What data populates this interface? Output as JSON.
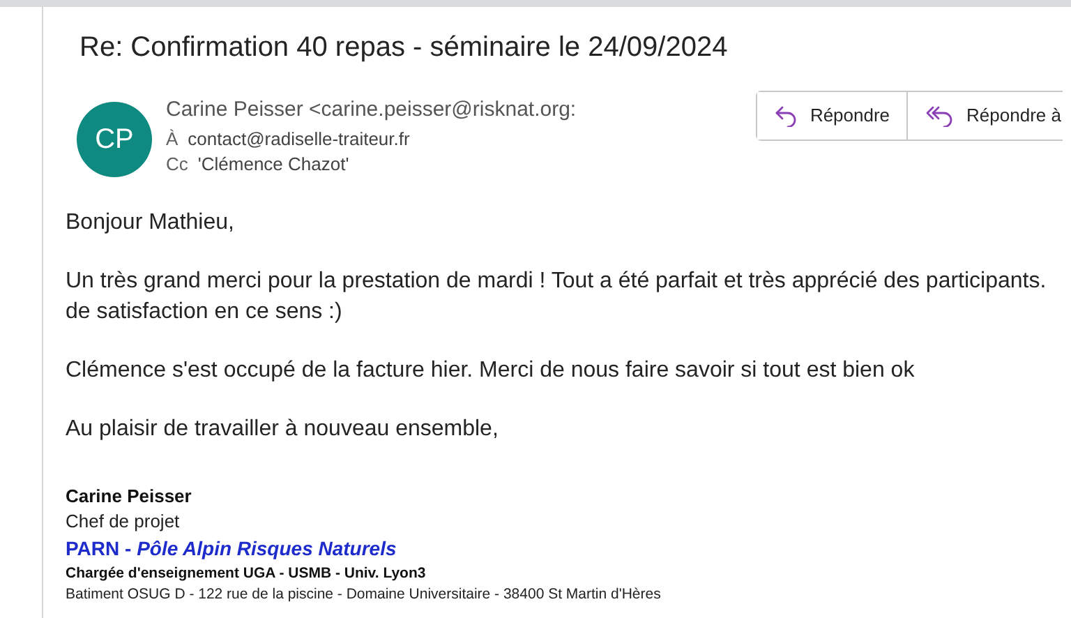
{
  "subject": "Re: Confirmation 40 repas - séminaire le 24/09/2024",
  "sender": {
    "initials": "CP",
    "from": "Carine Peisser <carine.peisser@risknat.org:",
    "to_label": "À",
    "to": "contact@radiselle-traiteur.fr",
    "cc_label": "Cc",
    "cc": "'Clémence Chazot'"
  },
  "actions": [
    {
      "kind": "reply",
      "label": "Répondre"
    },
    {
      "kind": "reply-all",
      "label": "Répondre à"
    }
  ],
  "body": [
    [
      "Bonjour Mathieu,"
    ],
    [
      "Un très grand merci pour la prestation de mardi ! Tout a été parfait et très apprécié des participants.",
      "de satisfaction en ce sens :)"
    ],
    [
      "Clémence s'est occupé de la facture hier. Merci de nous faire savoir si tout est bien ok"
    ],
    [
      "Au plaisir de travailler à nouveau ensemble,"
    ]
  ],
  "signature": [
    {
      "kind": "name",
      "text": "Carine Peisser"
    },
    {
      "kind": "role",
      "text": "Chef de projet"
    },
    {
      "kind": "org",
      "text": "PARN - *Pôle Alpin Risques Naturels*"
    },
    {
      "kind": "title",
      "text": "Chargée d'enseignement UGA - USMB - Univ. Lyon3"
    },
    {
      "kind": "address",
      "text": "Batiment OSUG D - 122 rue de la piscine - Domaine Universitaire - 38400 St Martin d'Hères"
    }
  ]
}
